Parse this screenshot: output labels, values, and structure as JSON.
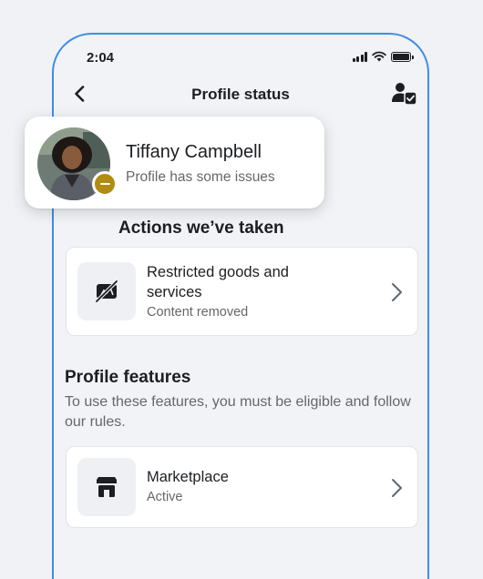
{
  "status_bar": {
    "time": "2:04"
  },
  "nav": {
    "title": "Profile status"
  },
  "profile": {
    "name": "Tiffany Campbell",
    "status_text": "Profile has some issues",
    "badge_color": "#b08c13"
  },
  "actions_section": {
    "title": "Actions we’ve taken",
    "items": [
      {
        "title": "Restricted goods and services",
        "subtitle": "Content removed",
        "icon": "restricted-goods-icon"
      }
    ]
  },
  "features_section": {
    "title": "Profile features",
    "description": "To use these features, you must be eligible and follow our rules.",
    "items": [
      {
        "title": "Marketplace",
        "subtitle": "Active",
        "icon": "marketplace-shop-icon"
      }
    ]
  },
  "colors": {
    "frame": "#3f8de6",
    "background": "#f1f3f6",
    "text": "#1c1e21",
    "secondary_text": "#65676b"
  }
}
